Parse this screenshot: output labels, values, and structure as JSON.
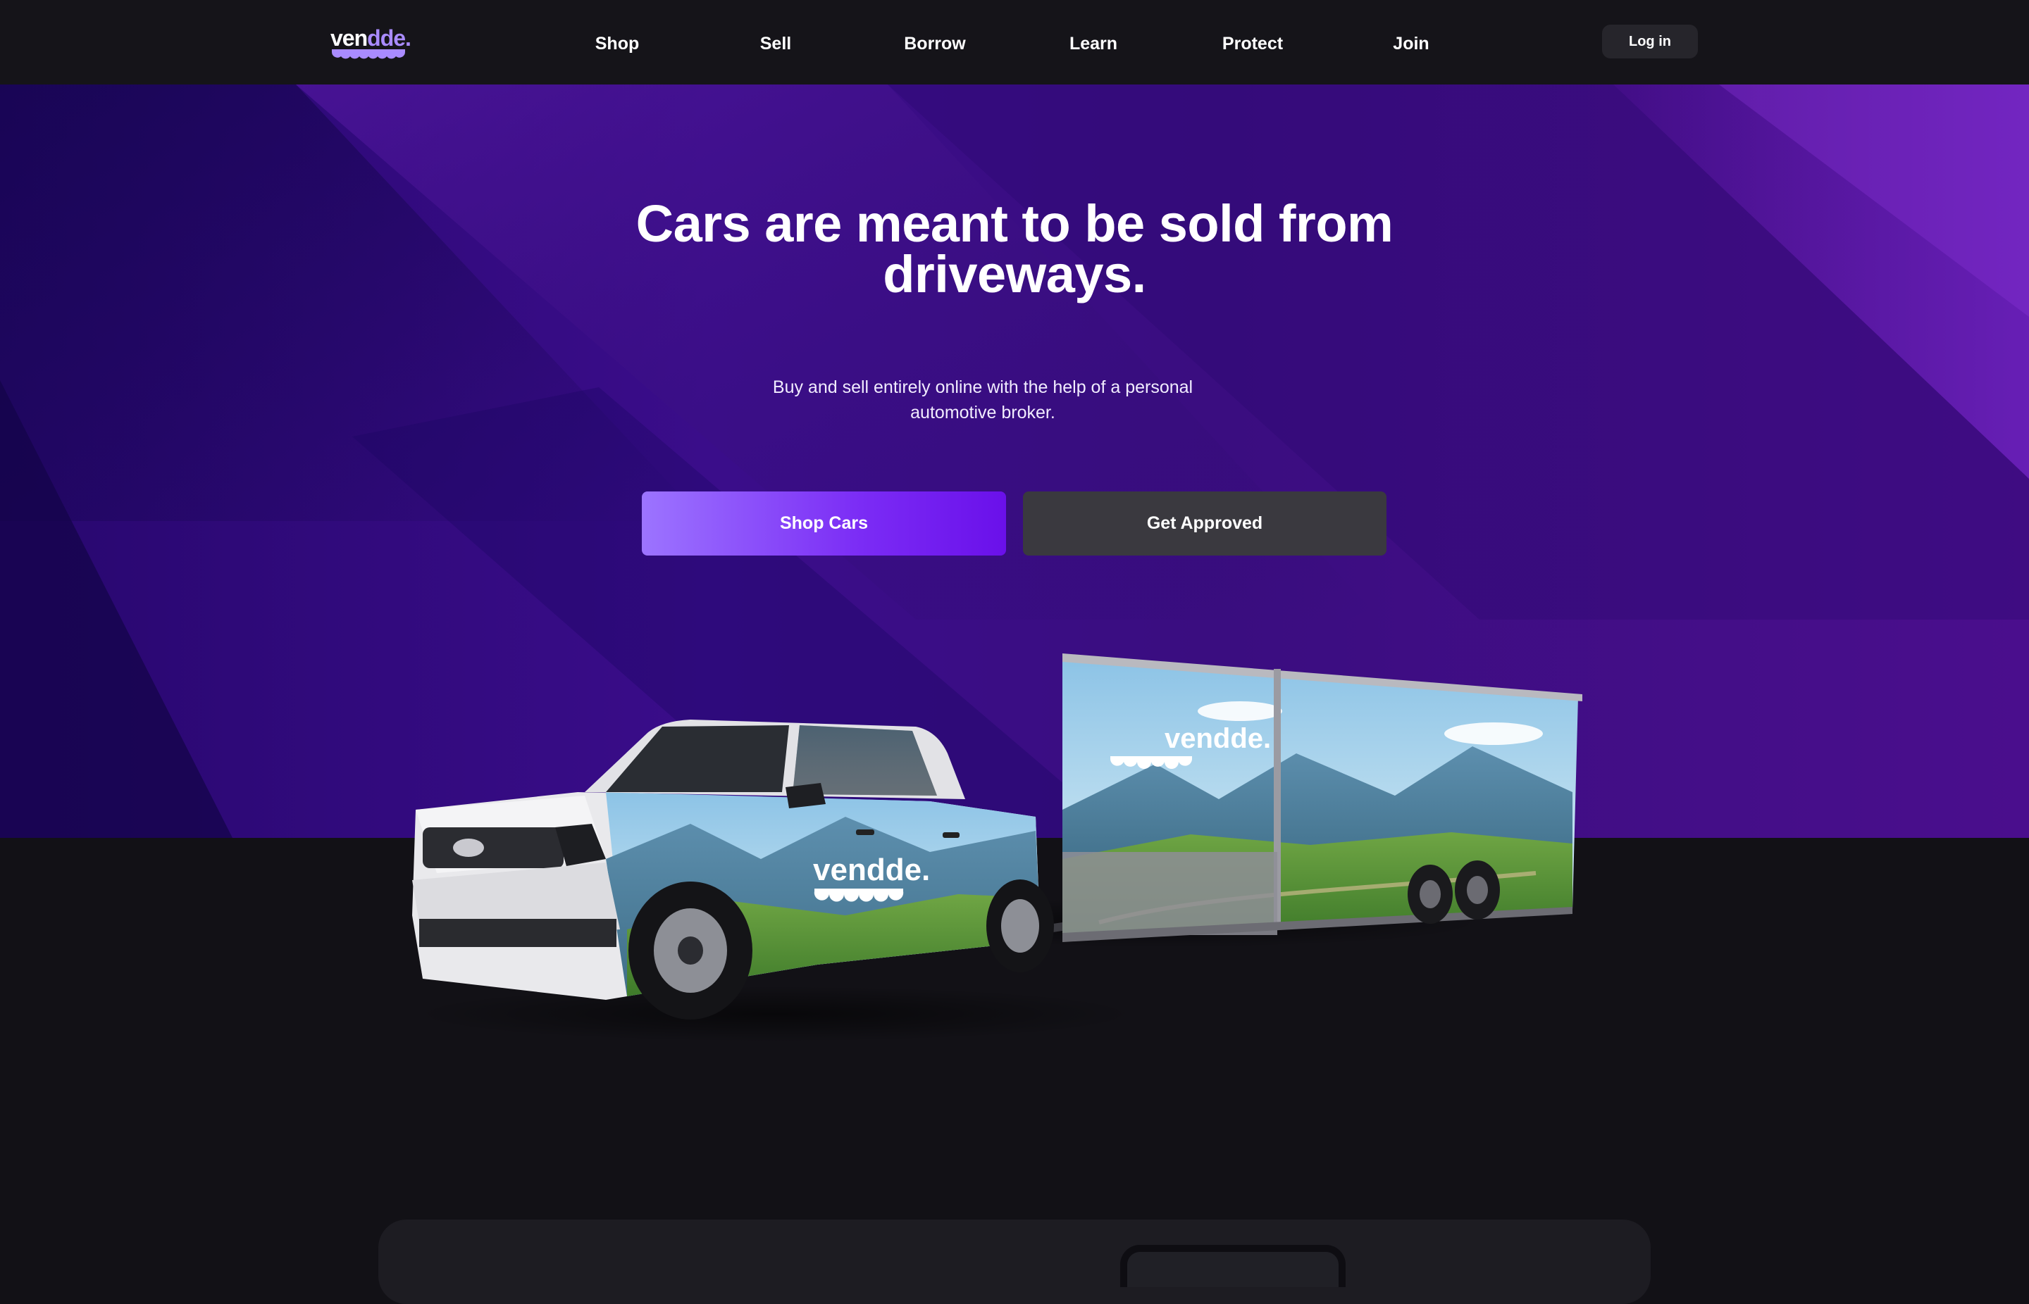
{
  "brand": {
    "logo_text_a": "ven",
    "logo_text_b": "dde."
  },
  "nav": {
    "links": [
      "Shop",
      "Sell",
      "Borrow",
      "Learn",
      "Protect",
      "Join"
    ],
    "login_label": "Log in"
  },
  "hero": {
    "headline_line1": "Cars are meant to be sold from",
    "headline_line2": "driveways.",
    "subtitle_line1": "Buy and sell entirely online with the help of a personal",
    "subtitle_line2": "automotive broker.",
    "primary_cta": "Shop Cars",
    "secondary_cta": "Get Approved",
    "truck_wrap_logo": "vendde.",
    "trailer_wrap_logo": "vendde."
  },
  "colors": {
    "nav_bg": "#151419",
    "hero_purple": "#3a0d8a",
    "accent_violet": "#7b2cf5",
    "logo_accent": "#a98bff",
    "page_bg": "#121116"
  }
}
